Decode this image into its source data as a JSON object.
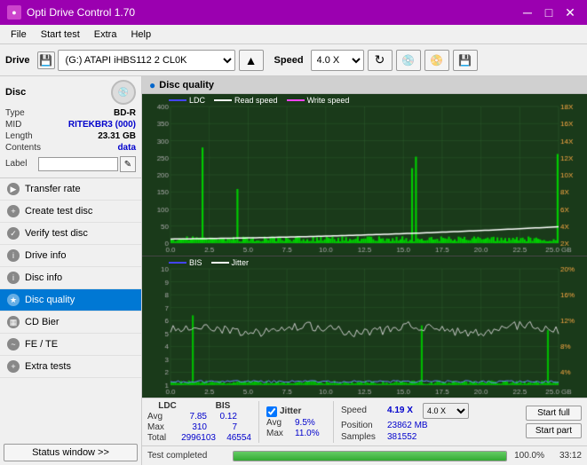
{
  "titleBar": {
    "title": "Opti Drive Control 1.70",
    "minimizeBtn": "─",
    "maximizeBtn": "□",
    "closeBtn": "✕"
  },
  "menuBar": {
    "items": [
      "File",
      "Start test",
      "Extra",
      "Help"
    ]
  },
  "toolbar": {
    "driveLabel": "Drive",
    "driveValue": "(G:) ATAPI iHBS112  2 CL0K",
    "speedLabel": "Speed",
    "speedValue": "4.0 X"
  },
  "disc": {
    "sectionTitle": "Disc",
    "typeLabel": "Type",
    "typeValue": "BD-R",
    "midLabel": "MID",
    "midValue": "RITEKBR3 (000)",
    "lengthLabel": "Length",
    "lengthValue": "23.31 GB",
    "contentsLabel": "Contents",
    "contentsValue": "data",
    "labelLabel": "Label",
    "labelValue": ""
  },
  "navItems": [
    {
      "id": "transfer-rate",
      "label": "Transfer rate",
      "active": false
    },
    {
      "id": "create-test-disc",
      "label": "Create test disc",
      "active": false
    },
    {
      "id": "verify-test-disc",
      "label": "Verify test disc",
      "active": false
    },
    {
      "id": "drive-info",
      "label": "Drive info",
      "active": false
    },
    {
      "id": "disc-info",
      "label": "Disc info",
      "active": false
    },
    {
      "id": "disc-quality",
      "label": "Disc quality",
      "active": true
    },
    {
      "id": "cd-bier",
      "label": "CD Bier",
      "active": false
    },
    {
      "id": "fe-te",
      "label": "FE / TE",
      "active": false
    },
    {
      "id": "extra-tests",
      "label": "Extra tests",
      "active": false
    }
  ],
  "statusWindowBtn": "Status window >>",
  "discQuality": {
    "title": "Disc quality"
  },
  "chart1": {
    "legend": [
      {
        "id": "ldc",
        "label": "LDC"
      },
      {
        "id": "read",
        "label": "Read speed"
      },
      {
        "id": "write",
        "label": "Write speed"
      }
    ],
    "yAxisLeft": [
      "400",
      "350",
      "300",
      "250",
      "200",
      "150",
      "100",
      "50",
      "0"
    ],
    "yAxisRight": [
      "18X",
      "16X",
      "14X",
      "12X",
      "10X",
      "8X",
      "6X",
      "4X",
      "2X"
    ],
    "xAxis": [
      "0.0",
      "2.5",
      "5.0",
      "7.5",
      "10.0",
      "12.5",
      "15.0",
      "17.5",
      "20.0",
      "22.5",
      "25.0 GB"
    ]
  },
  "chart2": {
    "legend": [
      {
        "id": "bis",
        "label": "BIS"
      },
      {
        "id": "jitter",
        "label": "Jitter"
      }
    ],
    "yAxisLeft": [
      "10",
      "9",
      "8",
      "7",
      "6",
      "5",
      "4",
      "3",
      "2",
      "1"
    ],
    "yAxisRight": [
      "20%",
      "16%",
      "12%",
      "8%",
      "4%"
    ],
    "xAxis": [
      "0.0",
      "2.5",
      "5.0",
      "7.5",
      "10.0",
      "12.5",
      "15.0",
      "17.5",
      "20.0",
      "22.5",
      "25.0 GB"
    ]
  },
  "stats": {
    "ldcLabel": "LDC",
    "bisLabel": "BIS",
    "jitterLabel": "Jitter",
    "speedLabel": "Speed",
    "positionLabel": "Position",
    "samplesLabel": "Samples",
    "avgLabel": "Avg",
    "maxLabel": "Max",
    "totalLabel": "Total",
    "ldcAvg": "7.85",
    "ldcMax": "310",
    "ldcTotal": "2996103",
    "bisAvg": "0.12",
    "bisMax": "7",
    "bisTotal": "46554",
    "jitterAvg": "9.5%",
    "jitterMax": "11.0%",
    "speedVal": "4.19 X",
    "speedSelect": "4.0 X",
    "positionVal": "23862 MB",
    "samplesVal": "381552",
    "startFullBtn": "Start full",
    "startPartBtn": "Start part"
  },
  "progress": {
    "statusLabel": "Test completed",
    "percent": "100.0%",
    "time": "33:12",
    "fillWidth": "100"
  },
  "colors": {
    "accent": "#9b00b0",
    "activeNav": "#0078d4",
    "chartBg": "#1e3a1e",
    "ldcColor": "#4488ff",
    "bisColor": "#4488ff",
    "readSpeedColor": "#ffffff",
    "jitterColor": "#ffffff",
    "writeSpeedColor": "#ff88ff",
    "ldcBarColor": "#00dd00",
    "jitterBarColor": "#00cc00"
  }
}
